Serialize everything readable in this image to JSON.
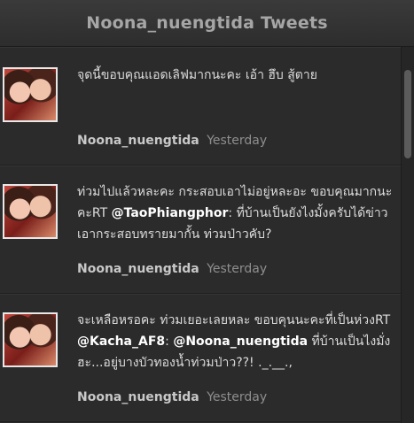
{
  "header": {
    "title": "Noona_nuengtida Tweets"
  },
  "tweets": [
    {
      "text": "จุดนี้ขอบคุณแอดเลิฟมากนะคะ เอ้า ฮึบ สู้ตาย",
      "author": "Noona_nuengtida",
      "time": "Yesterday"
    },
    {
      "text_before": "ท่วมไปแล้วหละคะ กระสอบเอาไม่อยู่หละอะ ขอบคุณมากนะคะRT ",
      "mention1": "@TaoPhiangphor",
      "text_after": ": ที่บ้านเป็นยังไงมั้งครับได้ข่าวเอากระสอบทรายมากั้น ท่วมป่าวคับ?",
      "author": "Noona_nuengtida",
      "time": "Yesterday"
    },
    {
      "text_before": "จะเหลือหรอคะ ท่วมเยอะเลยหละ ขอบคุนนะคะที่เป็นห่วงRT ",
      "mention1": "@Kacha_AF8",
      "text_mid": ": ",
      "mention2": "@Noona_nuengtida",
      "text_after": " ที่บ้านเป็นไงมั่งฮะ...อยู่บางบัวทองน้ำท่วมป่าว??! ._.__.,",
      "author": "Noona_nuengtida",
      "time": "Yesterday"
    }
  ]
}
